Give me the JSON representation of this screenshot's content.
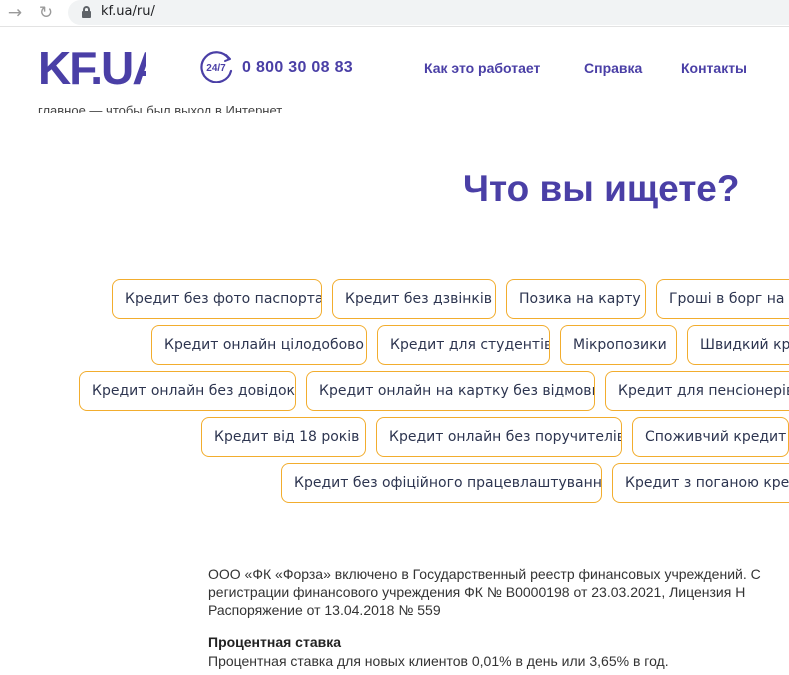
{
  "browser": {
    "url": "kf.ua/ru/",
    "back_icon": "arrow-back-icon",
    "reload_icon": "reload-icon",
    "lock_icon": "lock-icon"
  },
  "header": {
    "logo_text": "KF.UA",
    "support_badge": "24/7",
    "phone": "0 800 30 08 83",
    "nav": {
      "how_it_works": "Как это работает",
      "help": "Справка",
      "contacts": "Контакты"
    },
    "clipped_text": "главное — чтобы был выход в Интернет"
  },
  "main": {
    "title": "Что вы ищете?",
    "tags": [
      "Кредит без фото паспорта",
      "Кредит без дзвінків",
      "Позика на карту",
      "Гроші в борг на карту",
      "Кредит онлайн цілодобово",
      "Кредит для студентів",
      "Мікропозики",
      "Швидкий кредит",
      "Кредит онлайн без довідок",
      "Кредит онлайн на картку без відмови",
      "Кредит для пенсіонерів",
      "Кредит від 18 років",
      "Кредит онлайн без поручителів",
      "Споживчий кредит",
      "Кредит без офіційного працевлаштування",
      "Кредит з поганою кредитною історією"
    ]
  },
  "legal": {
    "line1": "ООО «ФК «Форза» включено в Государственный реестр финансовых учреждений. С",
    "line2": "регистрации финансового учреждения ФК № В0000198 от 23.03.2021, Лицензия Н",
    "line3": "Распоряжение от 13.04.2018 № 559",
    "rate_title": "Процентная ставка",
    "rate_text": "Процентная ставка для новых клиентов 0,01% в день или 3,65% в год."
  },
  "colors": {
    "brand": "#4a3fa6",
    "tag_border": "#f2ad2e",
    "tag_text": "#2d3550"
  }
}
